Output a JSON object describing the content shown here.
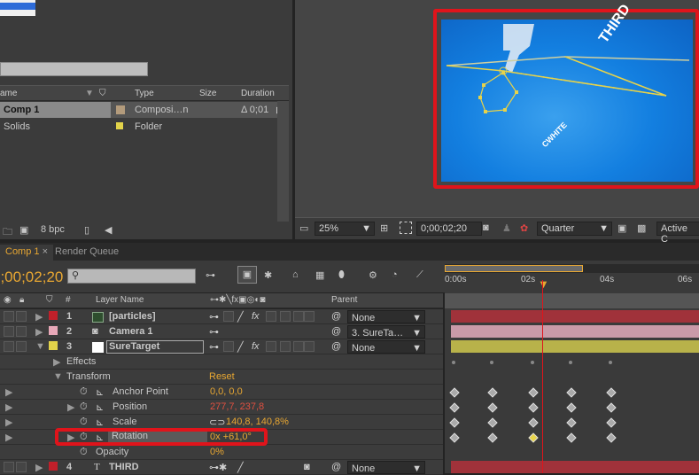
{
  "project": {
    "columns": {
      "name": "ame",
      "type": "Type",
      "size": "Size",
      "duration": "Duration"
    },
    "items": [
      {
        "name": "Comp 1",
        "type": "Composi…n",
        "duration": "Δ 0;01",
        "color": "#b39b7c"
      },
      {
        "name": "Solids",
        "type": "Folder",
        "duration": "",
        "color": "#e2d34a"
      }
    ],
    "bpc": "8 bpc"
  },
  "viewer": {
    "zoom": "25%",
    "timecode": "0;00;02;20",
    "resolution": "Quarter",
    "camera": "Active C",
    "comp_text_1": "THIRD",
    "comp_text_2": "CWHITE"
  },
  "timeline": {
    "tabs": [
      "Comp 1",
      "Render Queue"
    ],
    "current_time": "0;00;02;20",
    "header": {
      "num": "#",
      "layer_name": "Layer Name",
      "parent": "Parent"
    },
    "ruler": [
      "0:00s",
      "02s",
      "04s",
      "06s"
    ],
    "layers": [
      {
        "num": "1",
        "name": "[particles]",
        "label_color": "#c0202a",
        "parent": "None"
      },
      {
        "num": "2",
        "name": "Camera 1",
        "label_color": "#e8a8b8",
        "parent": "3. SureTa…"
      },
      {
        "num": "3",
        "name": "SureTarget",
        "label_color": "#e2d34a",
        "parent": "None"
      },
      {
        "num": "4",
        "name": "THIRD",
        "label_color": "#c0202a",
        "parent": "None"
      }
    ],
    "groups": {
      "effects": "Effects",
      "transform": "Transform",
      "reset": "Reset"
    },
    "properties": [
      {
        "name": "Anchor Point",
        "value": "0,0, 0,0",
        "value_color": "#e8a732"
      },
      {
        "name": "Position",
        "value": "277,7, 237,8",
        "value_color": "#e05040"
      },
      {
        "name": "Scale",
        "value": "140,8, 140,8%",
        "value_color": "#e8a732"
      },
      {
        "name": "Rotation",
        "value": "0x +61,0°",
        "value_color": "#e8a732"
      },
      {
        "name": "Opacity",
        "value": "0%",
        "value_color": "#e8a732"
      }
    ]
  },
  "colors": {
    "accent": "#e8a732",
    "highlight_red": "#e0141b"
  }
}
